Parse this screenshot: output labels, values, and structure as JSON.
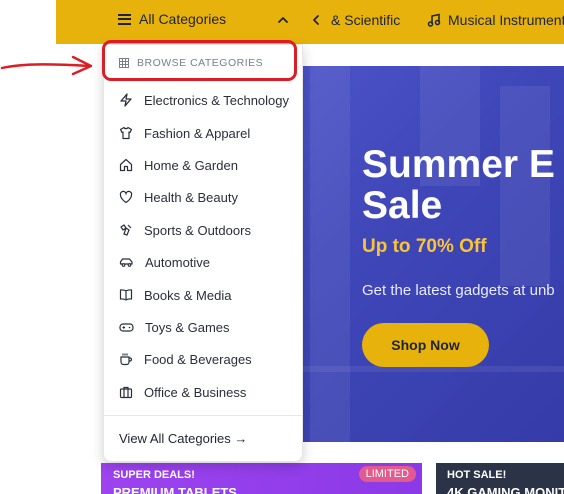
{
  "nav": {
    "all_categories_label": "All Categories",
    "partial_item_label": "& Scientific",
    "musical_instruments_label": "Musical Instruments"
  },
  "dropdown": {
    "header": "BROWSE CATEGORIES",
    "items": [
      {
        "label": "Electronics & Technology",
        "icon": "lightning-icon"
      },
      {
        "label": "Fashion & Apparel",
        "icon": "shirt-icon"
      },
      {
        "label": "Home & Garden",
        "icon": "home-icon"
      },
      {
        "label": "Health & Beauty",
        "icon": "heart-icon"
      },
      {
        "label": "Sports & Outdoors",
        "icon": "sports-icon"
      },
      {
        "label": "Automotive",
        "icon": "car-icon"
      },
      {
        "label": "Books & Media",
        "icon": "book-icon"
      },
      {
        "label": "Toys & Games",
        "icon": "gamepad-icon"
      },
      {
        "label": "Food & Beverages",
        "icon": "cup-icon"
      },
      {
        "label": "Office & Business",
        "icon": "briefcase-icon"
      }
    ],
    "footer": "View All Categories →"
  },
  "hero": {
    "title_line1": "Summer E",
    "title_line2": "Sale",
    "subtitle": "Up to 70% Off",
    "description": "Get the latest gadgets at unb",
    "cta_label": "Shop Now"
  },
  "promos": [
    {
      "tag": "SUPER DEALS!",
      "title": "PREMIUM TABLETS",
      "badge": "LIMITED"
    },
    {
      "tag": "HOT SALE!",
      "title": "4K GAMING MONIT"
    }
  ],
  "colors": {
    "brand_yellow": "#e8b20c",
    "hero_blue": "#4048bd",
    "annotation_red": "#d81f26"
  }
}
